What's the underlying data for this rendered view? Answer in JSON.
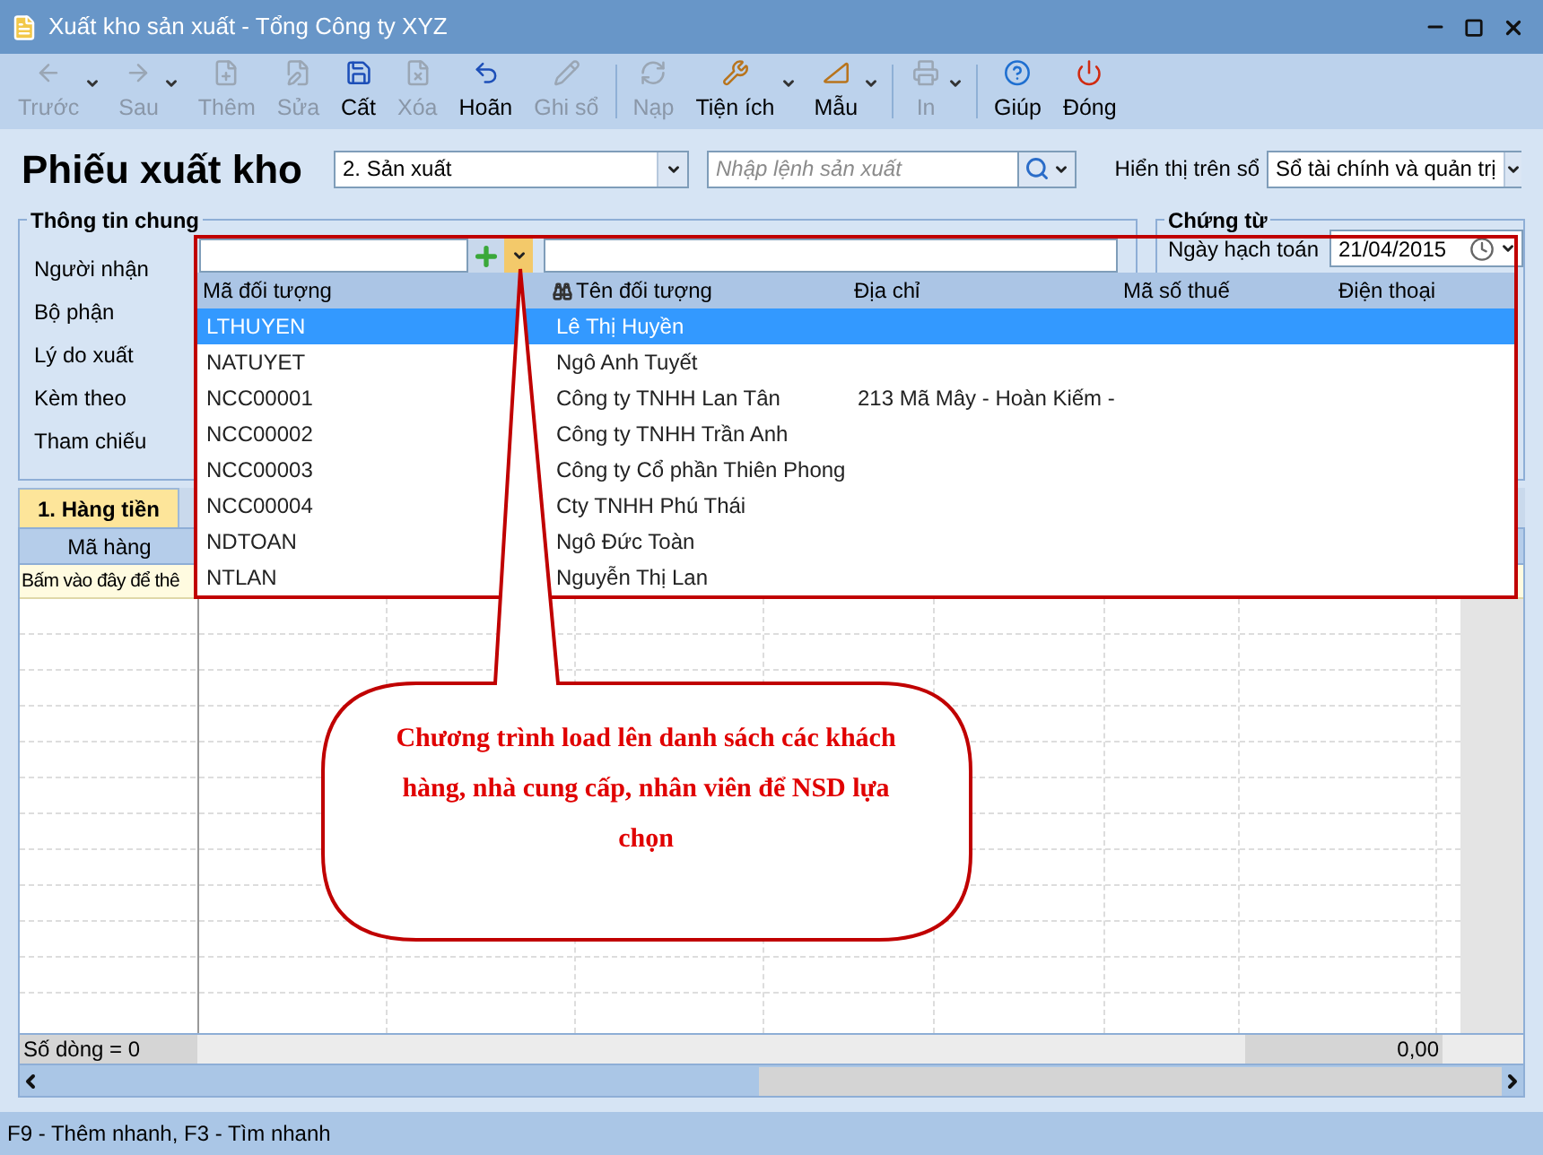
{
  "window": {
    "title": "Xuất kho sản xuất - Tổng Công ty XYZ"
  },
  "toolbar": {
    "groups": [
      [
        {
          "label": "Trước",
          "disabled": true,
          "has_menu": true
        },
        {
          "label": "Sau",
          "disabled": true,
          "has_menu": true
        },
        {
          "label": "Thêm",
          "disabled": true,
          "has_menu": false
        },
        {
          "label": "Sửa",
          "disabled": true,
          "has_menu": false
        },
        {
          "label": "Cất",
          "disabled": false,
          "has_menu": false
        },
        {
          "label": "Xóa",
          "disabled": true,
          "has_menu": false
        },
        {
          "label": "Hoãn",
          "disabled": false,
          "has_menu": false
        },
        {
          "label": "Ghi sổ",
          "disabled": true,
          "has_menu": false
        }
      ],
      [
        {
          "label": "Nạp",
          "disabled": true,
          "has_menu": false
        },
        {
          "label": "Tiện ích",
          "disabled": false,
          "has_menu": true
        },
        {
          "label": "Mẫu",
          "disabled": false,
          "has_menu": true
        }
      ],
      [
        {
          "label": "In",
          "disabled": true,
          "has_menu": true
        }
      ],
      [
        {
          "label": "Giúp",
          "disabled": false,
          "has_menu": false
        },
        {
          "label": "Đóng",
          "disabled": false,
          "has_menu": false
        }
      ]
    ]
  },
  "header": {
    "title": "Phiếu xuất kho",
    "type_select": {
      "value": "2. Sản xuất"
    },
    "command_search": {
      "placeholder": "Nhập lệnh sản xuất"
    },
    "ledger_label": "Hiển thị trên sổ",
    "ledger_select": {
      "value": "Sổ tài chính và quản trị"
    }
  },
  "general_info": {
    "title": "Thông tin chung",
    "fields": [
      {
        "label": "Người nhận"
      },
      {
        "label": "Bộ phận"
      },
      {
        "label": "Lý do xuất"
      },
      {
        "label": "Kèm theo"
      },
      {
        "label": "Tham chiếu"
      }
    ]
  },
  "voucher": {
    "title": "Chứng từ",
    "date_label": "Ngày hạch toán",
    "date_value": "21/04/2015"
  },
  "recipient_lookup": {
    "columns": [
      "Mã đối tượng",
      "Tên đối tượng",
      "Địa chỉ",
      "Mã số thuế",
      "Điện thoại"
    ],
    "rows": [
      {
        "code": "LTHUYEN",
        "name": "Lê Thị Huyền",
        "selected": true
      },
      {
        "code": "NATUYET",
        "name": "Ngô Anh Tuyết",
        "selected": false
      },
      {
        "code": "NCC00001",
        "name": "Công ty TNHH Lan Tân",
        "address": "213 Mã Mây - Hoàn Kiếm -",
        "selected": false
      },
      {
        "code": "NCC00002",
        "name": "Công ty TNHH Trần Anh",
        "selected": false
      },
      {
        "code": "NCC00003",
        "name": "Công ty Cổ phần Thiên Phong",
        "selected": false
      },
      {
        "code": "NCC00004",
        "name": "Cty TNHH Phú Thái",
        "selected": false
      },
      {
        "code": "NDTOAN",
        "name": "Ngô Đức Toàn",
        "selected": false
      },
      {
        "code": "NTLAN",
        "name": "Nguyễn Thị Lan",
        "selected": false
      }
    ]
  },
  "detail_tabs": [
    {
      "label": "1. Hàng tiền",
      "selected": true
    }
  ],
  "detail_grid": {
    "columns": [
      "Mã hàng"
    ],
    "new_row_hint": "Bấm vào đây để thê",
    "row_count": "Số dòng = 0",
    "total": "0,00"
  },
  "callout": {
    "text": "Chương trình load lên danh sách các khách hàng, nhà cung cấp, nhân viên để NSD lựa chọn"
  },
  "status_bar": {
    "text": "F9 - Thêm nhanh, F3 - Tìm nhanh"
  }
}
